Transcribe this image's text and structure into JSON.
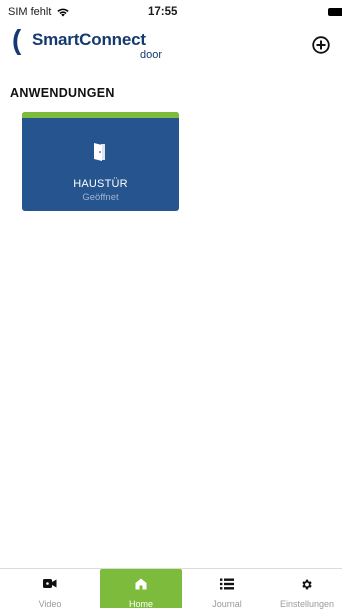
{
  "status_bar": {
    "carrier": "SIM fehlt",
    "time": "17:55"
  },
  "header": {
    "logo_main": "SmartConnect",
    "logo_sub": "door",
    "add_icon": "plus-circle-icon"
  },
  "section": {
    "title": "ANWENDUNGEN"
  },
  "tiles": [
    {
      "name": "HAUSTÜR",
      "status": "Geöffnet",
      "icon": "door-open-icon",
      "accent_color": "#7dbb3c",
      "background_color": "#26548e"
    }
  ],
  "bottom_nav": {
    "active": "Home",
    "items": [
      {
        "label": "Video",
        "icon": "video-camera-icon"
      },
      {
        "label": "Home",
        "icon": "home-icon"
      },
      {
        "label": "Journal",
        "icon": "list-icon"
      },
      {
        "label": "Einstellungen",
        "icon": "gear-icon"
      }
    ]
  },
  "colors": {
    "brand": "#163a70",
    "accent": "#7dbb3c",
    "tile": "#26548e"
  }
}
